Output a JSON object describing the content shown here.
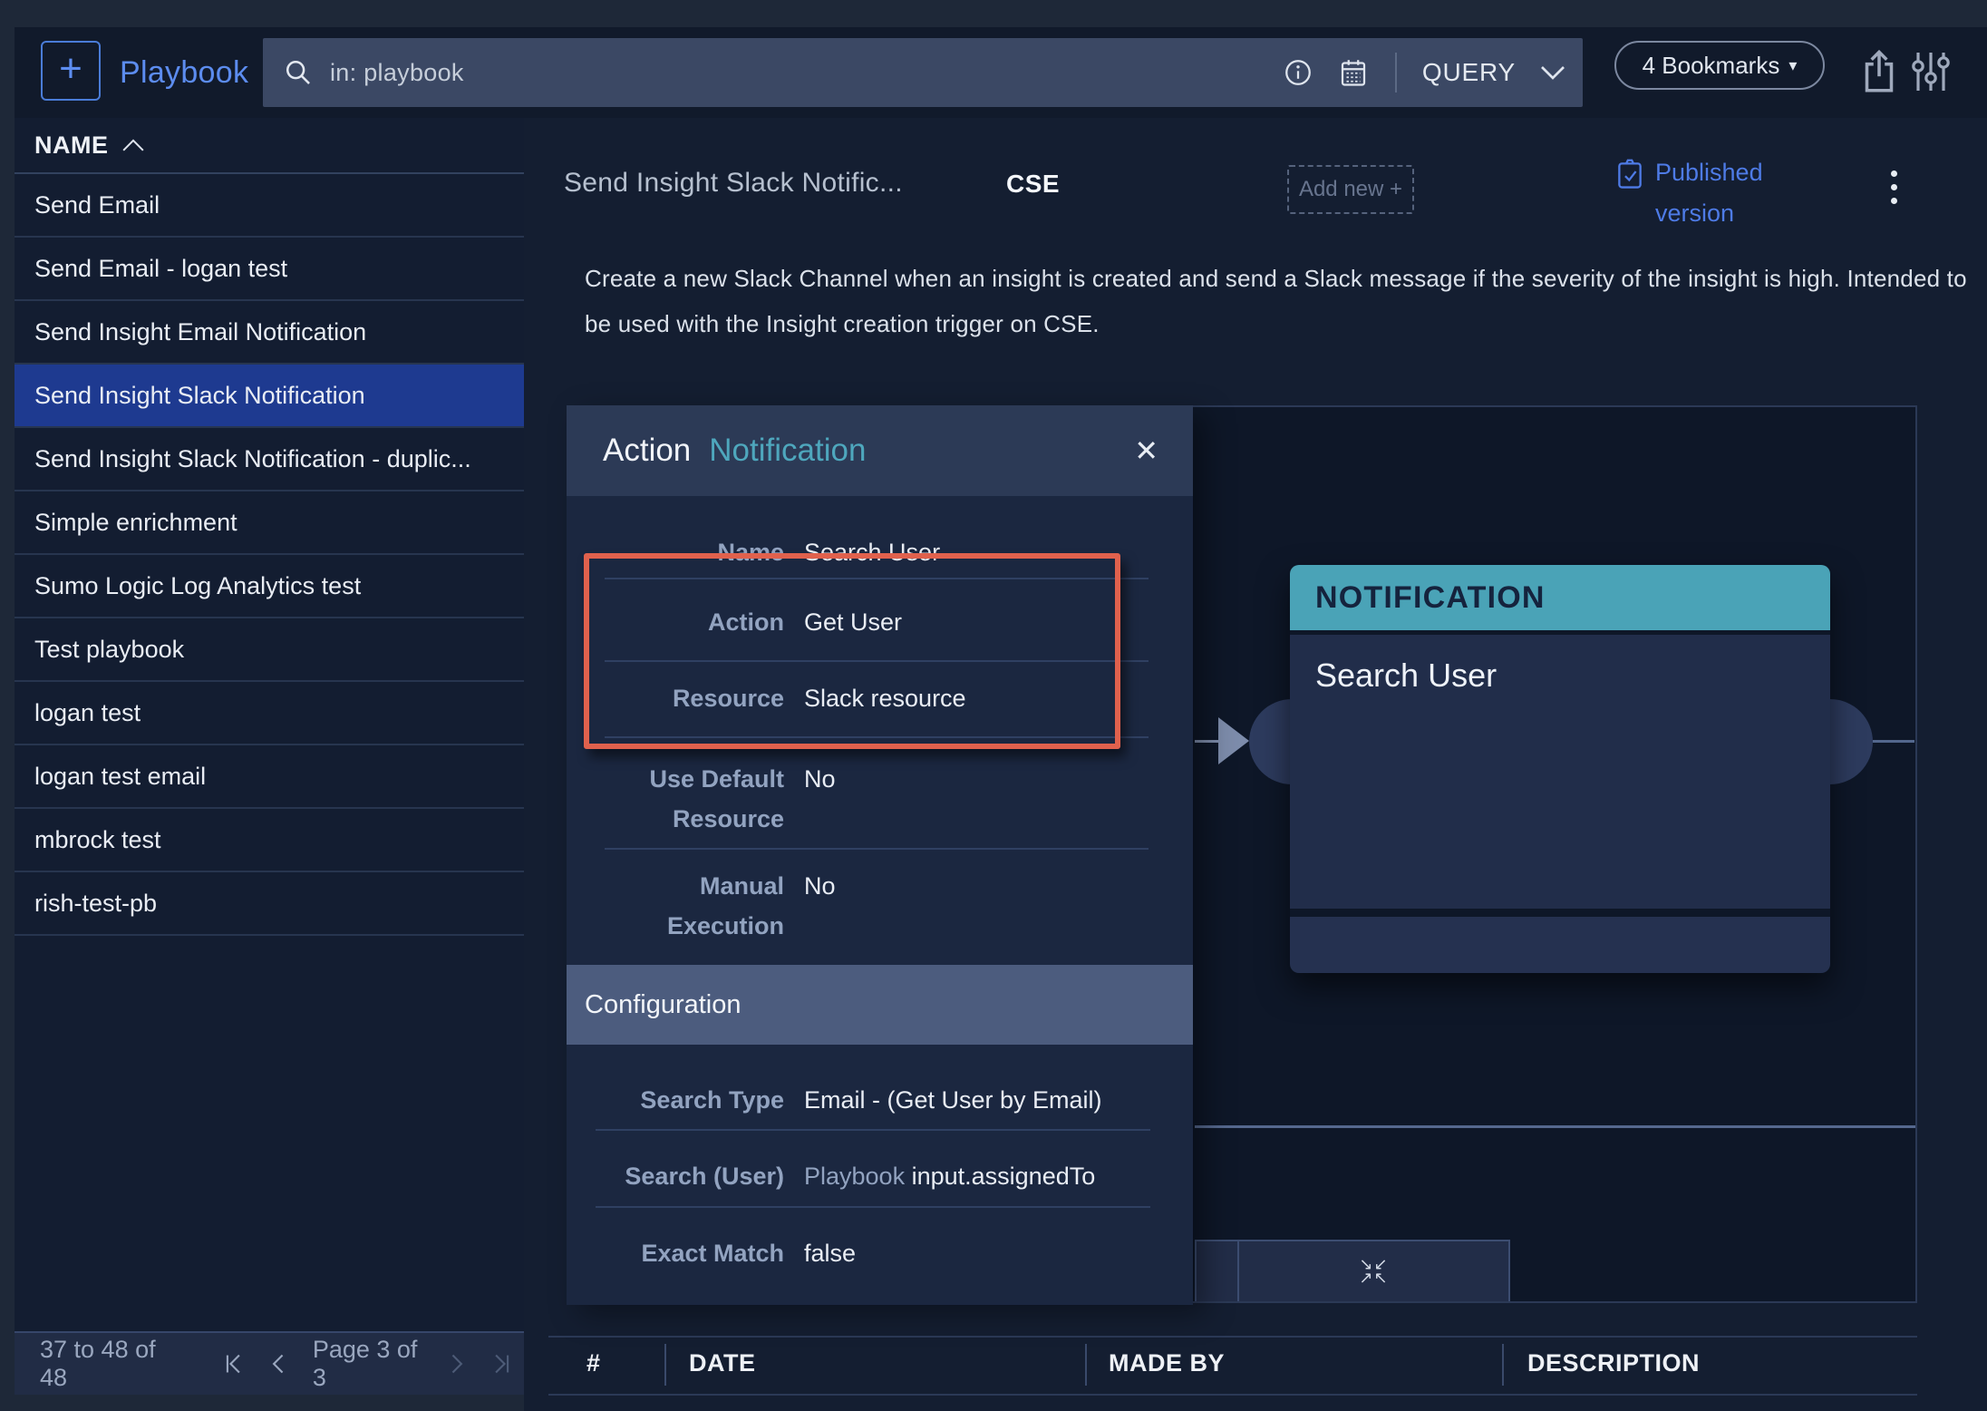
{
  "topbar": {
    "app_title": "Playbook",
    "search_value": "in: playbook",
    "query_label": "QUERY",
    "bookmarks_label": "4 Bookmarks"
  },
  "sidebar": {
    "column_header": "NAME",
    "items": [
      "Send Email",
      "Send Email - logan test",
      "Send Insight Email Notification",
      "Send Insight Slack Notification",
      "Send Insight Slack Notification - duplic...",
      "Simple enrichment",
      "Sumo Logic Log Analytics test",
      "Test playbook",
      "logan test",
      "logan test email",
      "mbrock test",
      "rish-test-pb"
    ],
    "selected_item": "Send Insight Slack Notification",
    "pagination": {
      "range_text": "37 to 48 of 48",
      "page_text": "Page 3 of 3"
    }
  },
  "header": {
    "title": "Send Insight Slack Notific...",
    "tag": "CSE",
    "add_new_label": "Add new +",
    "published_label": "Published version",
    "description": "Create a new Slack Channel when an insight is created and send a Slack message if the severity of the insight is high. Intended to be used with the Insight creation trigger on CSE."
  },
  "panel": {
    "type_label": "Action",
    "type_value": "Notification",
    "rows": [
      {
        "label": "Name",
        "value": "Search User"
      },
      {
        "label": "Action",
        "value": "Get User"
      },
      {
        "label": "Resource",
        "value": "Slack resource"
      },
      {
        "label": "Use Default Resource",
        "value": "No"
      },
      {
        "label": "Manual Execution",
        "value": "No"
      }
    ],
    "section_header": "Configuration",
    "config_rows": [
      {
        "label": "Search Type",
        "value": "Email - (Get User by Email)"
      },
      {
        "label": "Search (User)",
        "value_prefix": "Playbook",
        "value": "input.assignedTo"
      },
      {
        "label": "Exact Match",
        "value": "false"
      }
    ]
  },
  "canvas": {
    "node": {
      "type_header": "NOTIFICATION",
      "title": "Search User"
    }
  },
  "versions_table": {
    "columns": [
      "#",
      "DATE",
      "MADE BY",
      "DESCRIPTION"
    ]
  },
  "colors": {
    "accent_blue": "#5c8cef",
    "link_blue": "#4e7be6",
    "selected_row_blue": "#1e3a90",
    "node_teal": "#4aa3b7",
    "highlight_orange": "#e0614d"
  }
}
